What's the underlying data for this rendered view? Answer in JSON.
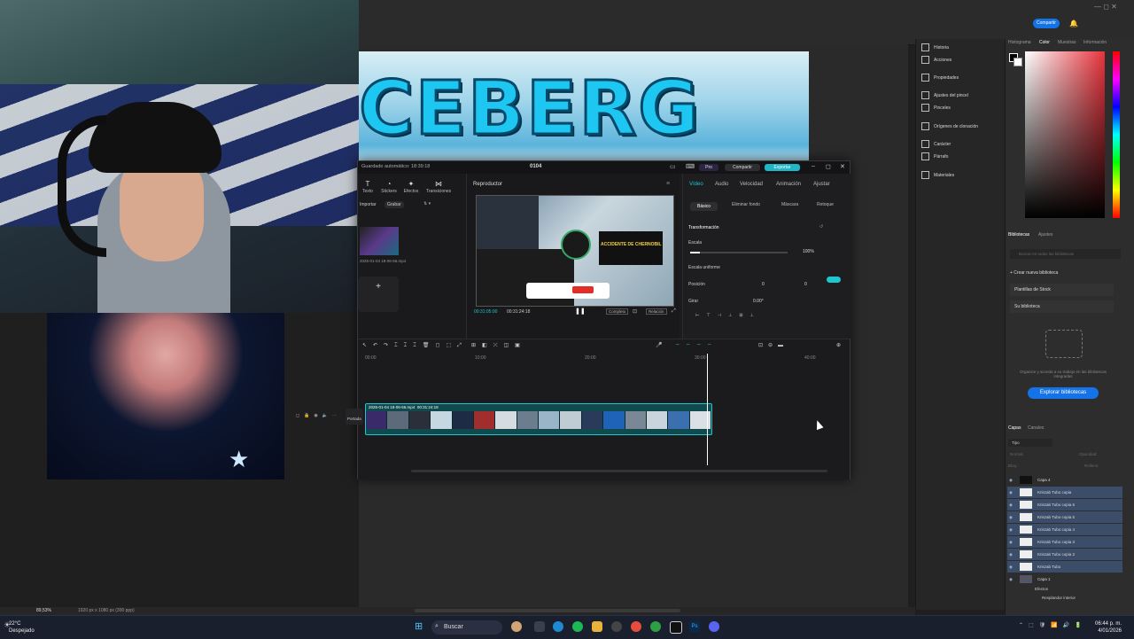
{
  "photoshop": {
    "share_label": "Compartir",
    "banner_text": "CEBERG",
    "mid_panel": [
      "Historia",
      "Acciones",
      "Propiedades",
      "Ajustes del pincel",
      "Pinceles",
      "Orígenes de clonación",
      "Carácter",
      "Párrafo",
      "Materiales"
    ],
    "top_tabs": [
      "Histograma",
      "Color",
      "Muestras",
      "Información"
    ],
    "lib_tabs": [
      "Bibliotecas",
      "Ajustes"
    ],
    "lib_search_placeholder": "Buscar en todas las bibliotecas",
    "create_library": "+ Crear nueva biblioteca",
    "library_items": [
      "Plantillas de Stock",
      "Su biblioteca"
    ],
    "library_hint": "Organice y acceda a su trabajo en las bibliotecas integradas",
    "explore_label": "Explorar bibliotecas",
    "layer_tabs": [
      "Capas",
      "Canales"
    ],
    "layer_kind": "Tipo",
    "blend_mode": "Normal",
    "opacity_label": "Opacidad:",
    "lock_label": "Bloq.:",
    "fill_label": "Relleno:",
    "layers": [
      "Capa 4",
      "Kriszab Tubo copia",
      "Kriszab Tubo copia 6",
      "Kriszab Tubo copia 5",
      "Kriszab Tubo copia 4",
      "Kriszab Tubo copia 3",
      "Kriszab Tubo copia 2",
      "Kriszab Tubo",
      "Capa 1",
      "Efectos",
      "Resplandor interior"
    ],
    "zoom": "89,53%",
    "doc_info": "1920 px x 1080 px (300 ppp)"
  },
  "capcut": {
    "autosave": "Guardado automático: 18:39:18",
    "project_name": "0104",
    "pro_label": "Pro",
    "share_label": "Compartir",
    "export_label": "Exportar",
    "media_tabs": [
      "Texto",
      "Stickers",
      "Efectos",
      "Transiciones"
    ],
    "import_label": "Importar",
    "record_label": "Grabar",
    "media_file": "2026-01-04 18-06-56.mp4",
    "player_title": "Reproductor",
    "time_current": "00:31:05:00",
    "time_total": "00:31:24:18",
    "complete_label": "Completo",
    "ratio_label": "Relación",
    "overlay_headline": "ACCIDENTE DE CHERNOBIL",
    "inspector_tabs": [
      "Vídeo",
      "Audio",
      "Velocidad",
      "Animación",
      "Ajustar"
    ],
    "inspector_subtabs": [
      "Básico",
      "Eliminar fondo",
      "Máscara",
      "Retoque"
    ],
    "transform_label": "Transformación",
    "scale_label": "Escala",
    "scale_value": "100%",
    "scale_level": 0.1,
    "uniform_label": "Escala uniforme",
    "position_label": "Posición",
    "pos_x": "0",
    "pos_y": "0",
    "rotate_label": "Girar",
    "rotate_value": "0.00°",
    "cover_label": "Portada",
    "ticks": [
      "00:00",
      "10:00",
      "20:00",
      "30:00",
      "40:00"
    ],
    "clip_name": "2026-01-04 18-06-56.mp4",
    "clip_duration": "00:31:24:18"
  },
  "taskbar": {
    "temp": "22°C",
    "weather": "Despejado",
    "search": "Buscar",
    "time": "06:44 p. m.",
    "date": "4/01/2026"
  }
}
